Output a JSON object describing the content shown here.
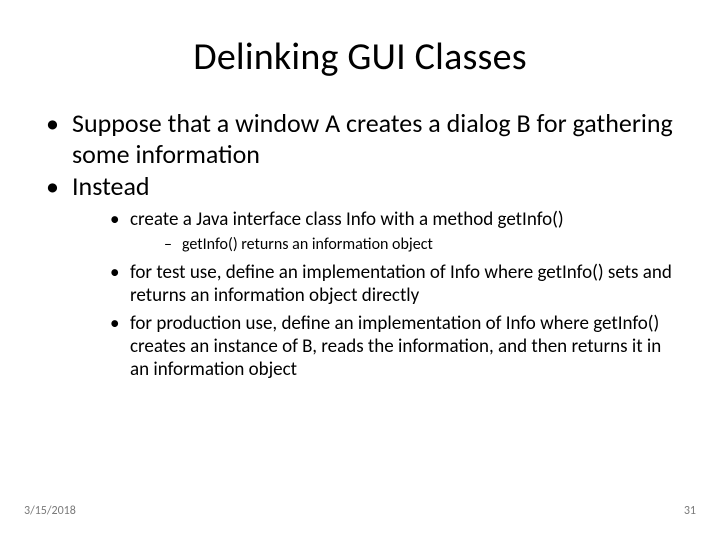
{
  "title": "Delinking GUI Classes",
  "bullets": {
    "p1": "Suppose that a window A creates a dialog B for gathering some information",
    "p2": "Instead",
    "s1": "create a Java interface class Info with a method getInfo()",
    "s1a": "getInfo() returns an information object",
    "s2": "for test use, define an implementation of Info where getInfo() sets and returns an information object directly",
    "s3": "for production use, define an implementation of Info where getInfo() creates an instance of B, reads the information, and then returns it in an information object"
  },
  "footer": {
    "date": "3/15/2018",
    "page": "31"
  }
}
